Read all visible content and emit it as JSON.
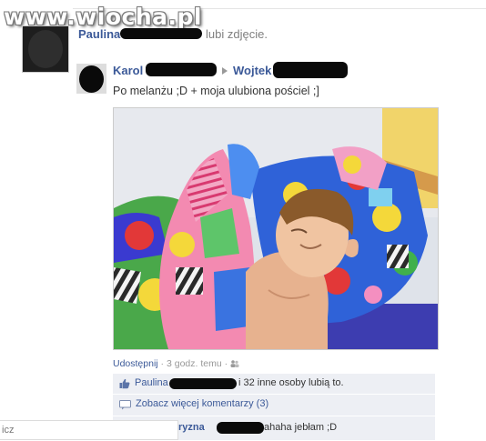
{
  "watermark": {
    "text": "www.wiocha.pl"
  },
  "activity": {
    "actor_name": "Paulina",
    "action_text": "lubi zdjęcie."
  },
  "post": {
    "author_name": "Karol",
    "target_name": "Wojtek",
    "caption": "Po melanżu ;D + moja ulubiona pościel ;]"
  },
  "meta": {
    "share_label": "Udostępnij",
    "separator": "·",
    "time_text": "3 godz. temu",
    "audience_icon": "people-icon"
  },
  "likes": {
    "icon": "thumbs-up-icon",
    "first_name": "Paulina",
    "rest_text": "i 32 inne osoby lubią to."
  },
  "more_comments": {
    "icon": "comment-bubble-icon",
    "label": "Zobacz więcej komentarzy (3)"
  },
  "comment": {
    "author_partial": "ryzna",
    "text": "ahaha jebłam ;D"
  },
  "left_panel": {
    "input_text": "icz"
  },
  "colors": {
    "link": "#3b5998",
    "row_bg": "#edeff4",
    "muted": "#999999"
  }
}
